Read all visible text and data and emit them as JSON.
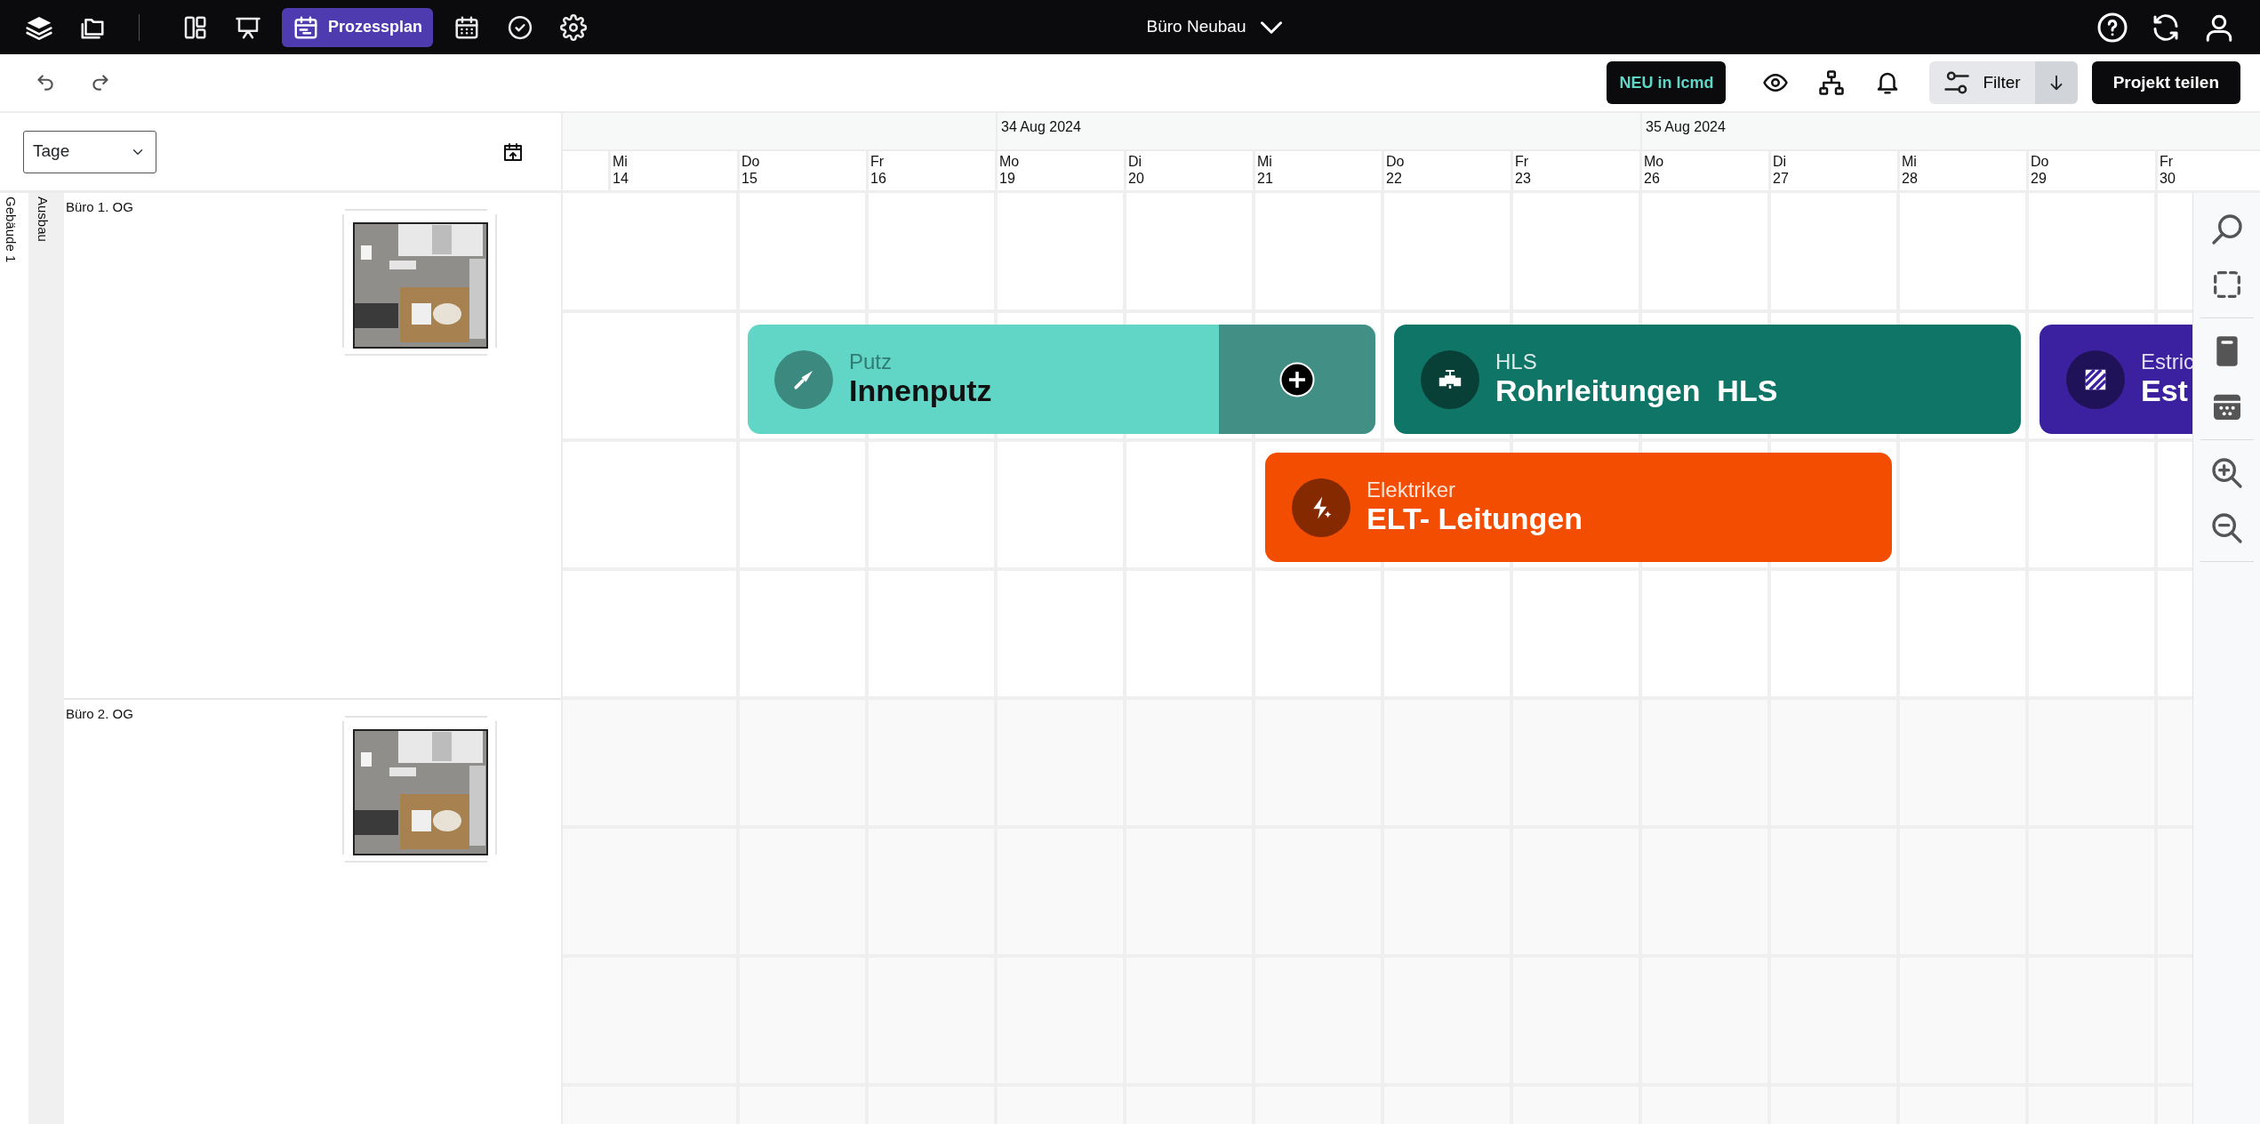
{
  "top_bar": {
    "nav": [
      {
        "selected": false
      },
      {
        "selected": false
      },
      {
        "label": "Prozessplan",
        "selected": true
      },
      {
        "selected": false
      },
      {
        "selected": false
      },
      {
        "selected": false
      }
    ],
    "project": "Büro Neubau"
  },
  "toolbar": {
    "news_button": "NEU in lcmd",
    "filter_button": "Filter",
    "share_button": "Projekt teilen"
  },
  "scale_select": {
    "value": "Tage"
  },
  "timeline": {
    "weeks": [
      {
        "label": "34 Aug 2024"
      },
      {
        "label": "35 Aug 2024"
      }
    ],
    "days": [
      {
        "weekday": "Mi",
        "day": "14"
      },
      {
        "weekday": "Do",
        "day": "15"
      },
      {
        "weekday": "Fr",
        "day": "16"
      },
      {
        "weekday": "Mo",
        "day": "19"
      },
      {
        "weekday": "Di",
        "day": "20"
      },
      {
        "weekday": "Mi",
        "day": "21"
      },
      {
        "weekday": "Do",
        "day": "22"
      },
      {
        "weekday": "Fr",
        "day": "23"
      },
      {
        "weekday": "Mo",
        "day": "26"
      },
      {
        "weekday": "Di",
        "day": "27"
      },
      {
        "weekday": "Mi",
        "day": "28"
      },
      {
        "weekday": "Do",
        "day": "29"
      },
      {
        "weekday": "Fr",
        "day": "30"
      }
    ]
  },
  "hierarchy": {
    "building": "Gebäude 1",
    "section": "Ausbau",
    "areas": [
      {
        "name": "Büro 1. OG"
      },
      {
        "name": "Büro 2. OG"
      }
    ]
  },
  "tasks": [
    {
      "category": "Putz",
      "title": "Innenputz",
      "color": "#61d6c7",
      "selected": true
    },
    {
      "category": "HLS",
      "title": "Rohrleitungen  HLS",
      "color": "#0f7566",
      "selected": false
    },
    {
      "category": "Estric",
      "title": "Est",
      "color": "#3b21a0",
      "selected": false
    },
    {
      "category": "Elektriker",
      "title": "ELT- Leitungen",
      "color": "#f24d00",
      "selected": false
    }
  ]
}
